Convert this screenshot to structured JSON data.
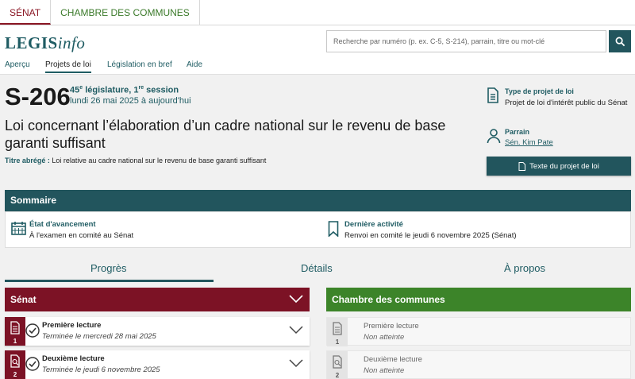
{
  "chambers": {
    "senat": "SÉNAT",
    "communes": "CHAMBRE DES COMMUNES"
  },
  "brand": {
    "bold": "LEGIS",
    "italic": "info"
  },
  "search": {
    "placeholder": "Recherche par numéro (p. ex. C-5, S-214), parrain, titre ou mot-clé"
  },
  "nav": [
    "Aperçu",
    "Projets de loi",
    "Législation en bref",
    "Aide"
  ],
  "bill": {
    "number": "S-206",
    "legislature_num": "45",
    "legislature_sup": "e",
    "legislature_mid": " législature, 1",
    "session_sup": "re",
    "session_word": " session",
    "dates": "lundi 26 mai 2025 à aujourd'hui",
    "title": "Loi concernant l’élaboration d’un cadre national sur le revenu de base garanti suffisant",
    "short_title_label": "Titre abrégé :",
    "short_title": " Loi relative au cadre national sur le revenu de base garanti suffisant"
  },
  "side": {
    "type_label": "Type de projet de loi",
    "type_value": "Projet de loi d'intérêt public du Sénat",
    "sponsor_label": "Parrain",
    "sponsor_value": "Sén. Kim Pate",
    "text_button": "Texte du projet de loi"
  },
  "summary": {
    "title": "Sommaire",
    "status_label": "État d'avancement",
    "status_value": "À l'examen en comité au Sénat",
    "activity_label": "Dernière activité",
    "activity_value": "Renvoi en comité le jeudi 6 novembre 2025 (Sénat)"
  },
  "tabs": [
    "Progrès",
    "Détails",
    "À propos"
  ],
  "progress": {
    "senat": {
      "title": "Sénat",
      "stages": [
        {
          "num": "1",
          "name": "Première lecture",
          "status": "Terminée le mercredi 28 mai 2025"
        },
        {
          "num": "2",
          "name": "Deuxième lecture",
          "status": "Terminée le jeudi 6 novembre 2025"
        }
      ]
    },
    "communes": {
      "title": "Chambre des communes",
      "stages": [
        {
          "num": "1",
          "name": "Première lecture",
          "status": "Non atteinte"
        },
        {
          "num": "2",
          "name": "Deuxième lecture",
          "status": "Non atteinte"
        }
      ]
    }
  },
  "colors": {
    "accent": "#22555d",
    "senat": "#7c1225",
    "communes": "#3c8429"
  }
}
